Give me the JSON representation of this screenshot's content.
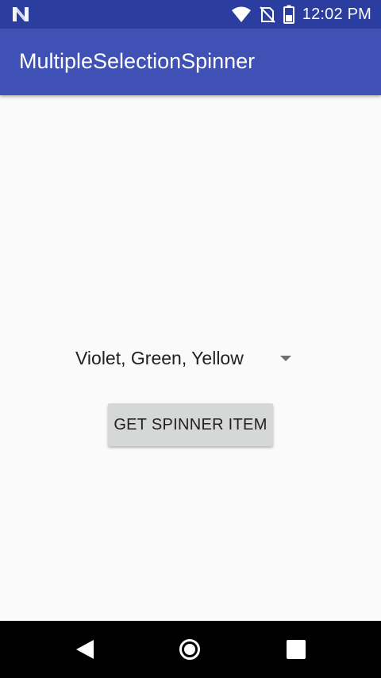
{
  "status_bar": {
    "time": "12:02 PM",
    "icons": [
      "android-n-icon",
      "wifi-icon",
      "no-sim-icon",
      "battery-icon"
    ]
  },
  "app_bar": {
    "title": "MultipleSelectionSpinner",
    "color": "#3f51b5",
    "status_color": "#2c3da0"
  },
  "main": {
    "spinner": {
      "selected_text": "Violet, Green, Yellow",
      "icon": "dropdown-arrow-icon"
    },
    "button": {
      "label": "GET SPINNER ITEM"
    }
  },
  "nav_bar": {
    "buttons": [
      "back-icon",
      "home-icon",
      "recents-icon"
    ]
  }
}
